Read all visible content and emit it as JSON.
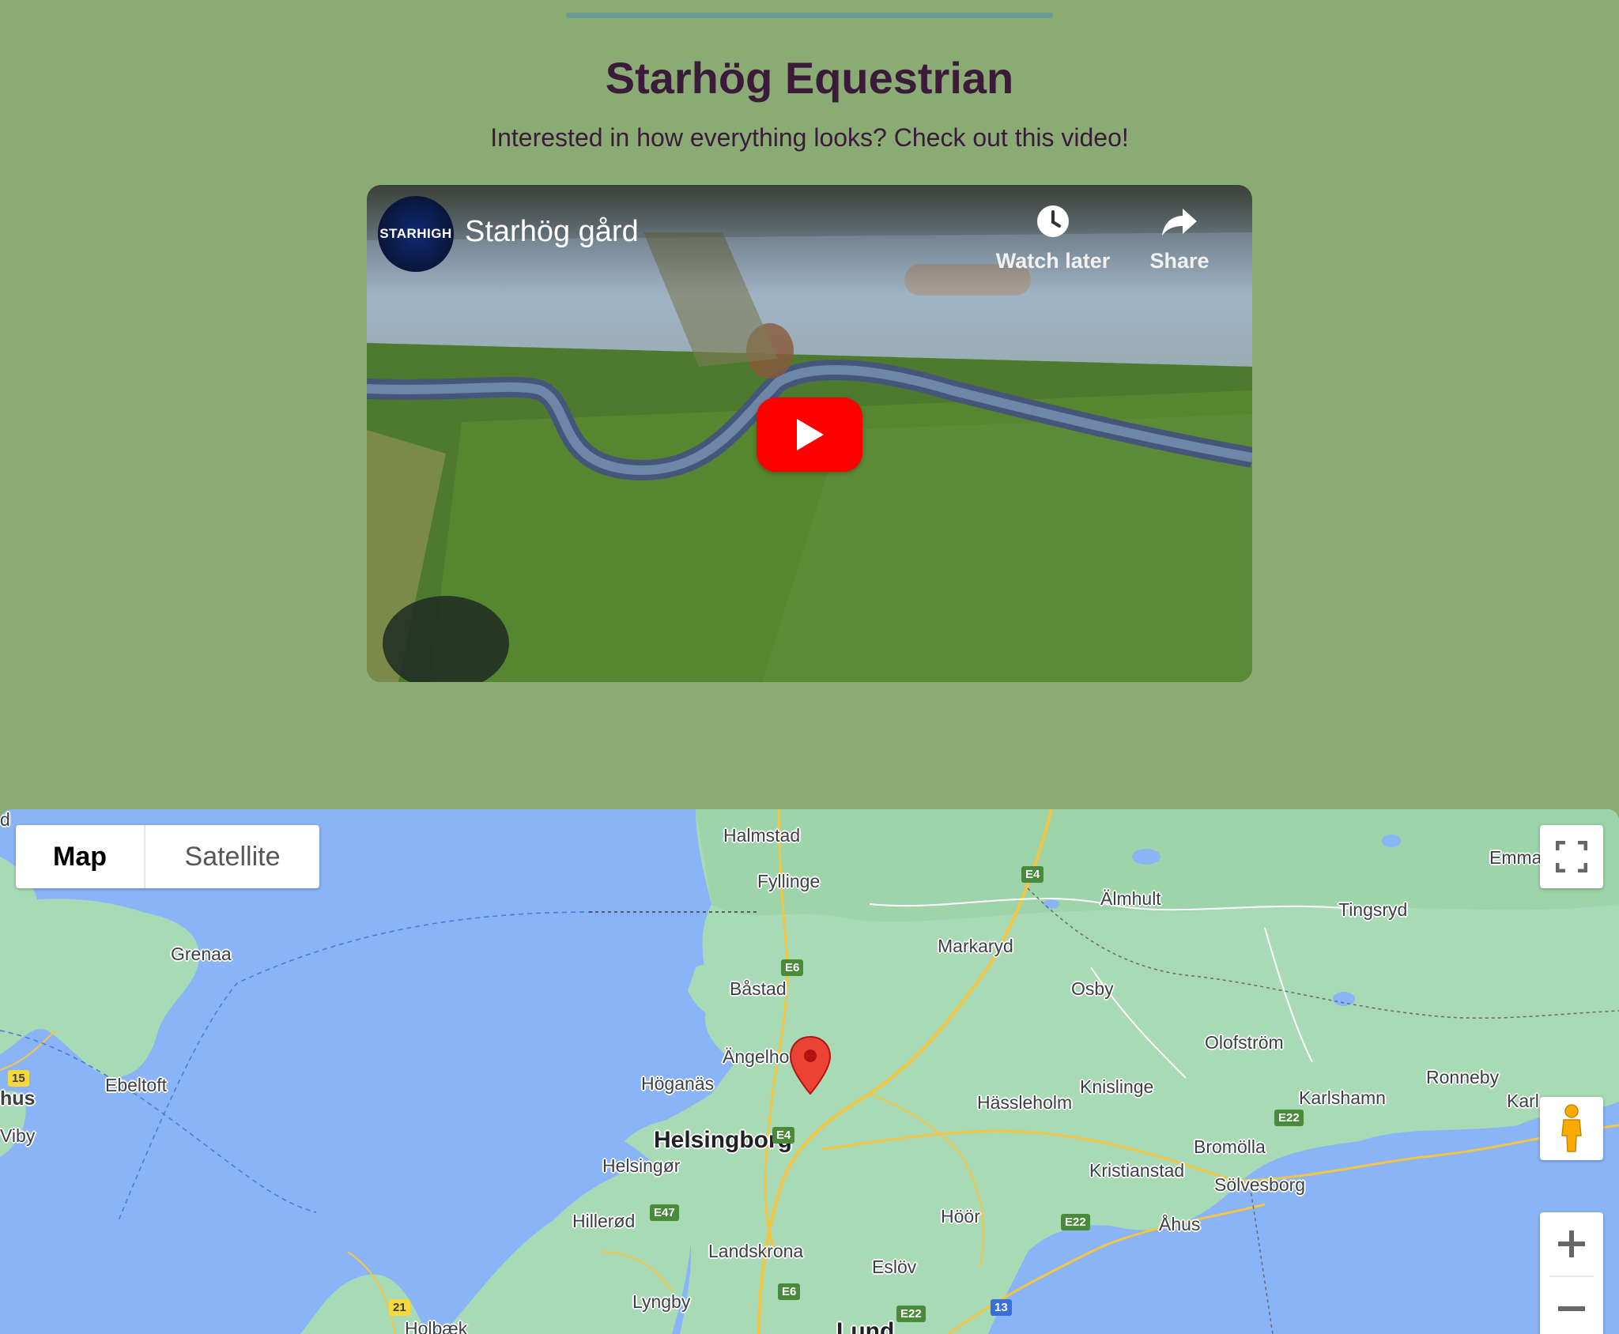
{
  "header": {
    "title": "Starhög Equestrian",
    "subtitle": "Interested in how everything looks? Check out this video!"
  },
  "video": {
    "channel_logo_text": "STARHIGH",
    "title": "Starhög gård",
    "watch_later_label": "Watch later",
    "share_label": "Share",
    "icons": [
      "clock-icon",
      "share-arrow-icon",
      "play-icon"
    ],
    "play_button_color": "#ff0000"
  },
  "map": {
    "type_options": [
      {
        "label": "Map",
        "selected": true
      },
      {
        "label": "Satellite",
        "selected": false
      }
    ],
    "places": {
      "halmstad": "Halmstad",
      "fyllinge": "Fyllinge",
      "almhult": "Älmhult",
      "tingsryd": "Tingsryd",
      "emma": "Emma",
      "grenaa": "Grenaa",
      "markaryd": "Markaryd",
      "bastad": "Båstad",
      "osby": "Osby",
      "olofstrom": "Olofström",
      "angelholm": "Ängelho",
      "ebeltoft": "Ebeltoft",
      "hoganas": "Höganäs",
      "knislinge": "Knislinge",
      "ronneby": "Ronneby",
      "karlshamn": "Karlshamn",
      "karl": "Karl",
      "hus": "hus",
      "hassleholm": "Hässleholm",
      "helsingborg": "Helsingborg",
      "bromolla": "Bromölla",
      "helsingor": "Helsingør",
      "kristianstad": "Kristianstad",
      "solvesborg": "Sölvesborg",
      "viby": "Viby",
      "hillerod": "Hillerød",
      "hoor": "Höör",
      "ahus": "Åhus",
      "landskrona": "Landskrona",
      "eslov": "Eslöv",
      "lyngby": "Lyngby",
      "lund": "Lund",
      "holbaek": "Holbæk",
      "d": "d"
    },
    "road_shields": [
      "E4",
      "E6",
      "E4",
      "E6",
      "E47",
      "E22",
      "E22",
      "E22",
      "E22",
      "13",
      "15",
      "21",
      "E6"
    ],
    "controls": {
      "fullscreen_icon": "fullscreen-icon",
      "pegman_icon": "pegman-icon",
      "zoom_in_icon": "plus-icon",
      "zoom_out_icon": "minus-icon"
    },
    "marker_color": "#ea4335",
    "water_color": "#8ab4f8",
    "land_color": "#a8dab5"
  }
}
